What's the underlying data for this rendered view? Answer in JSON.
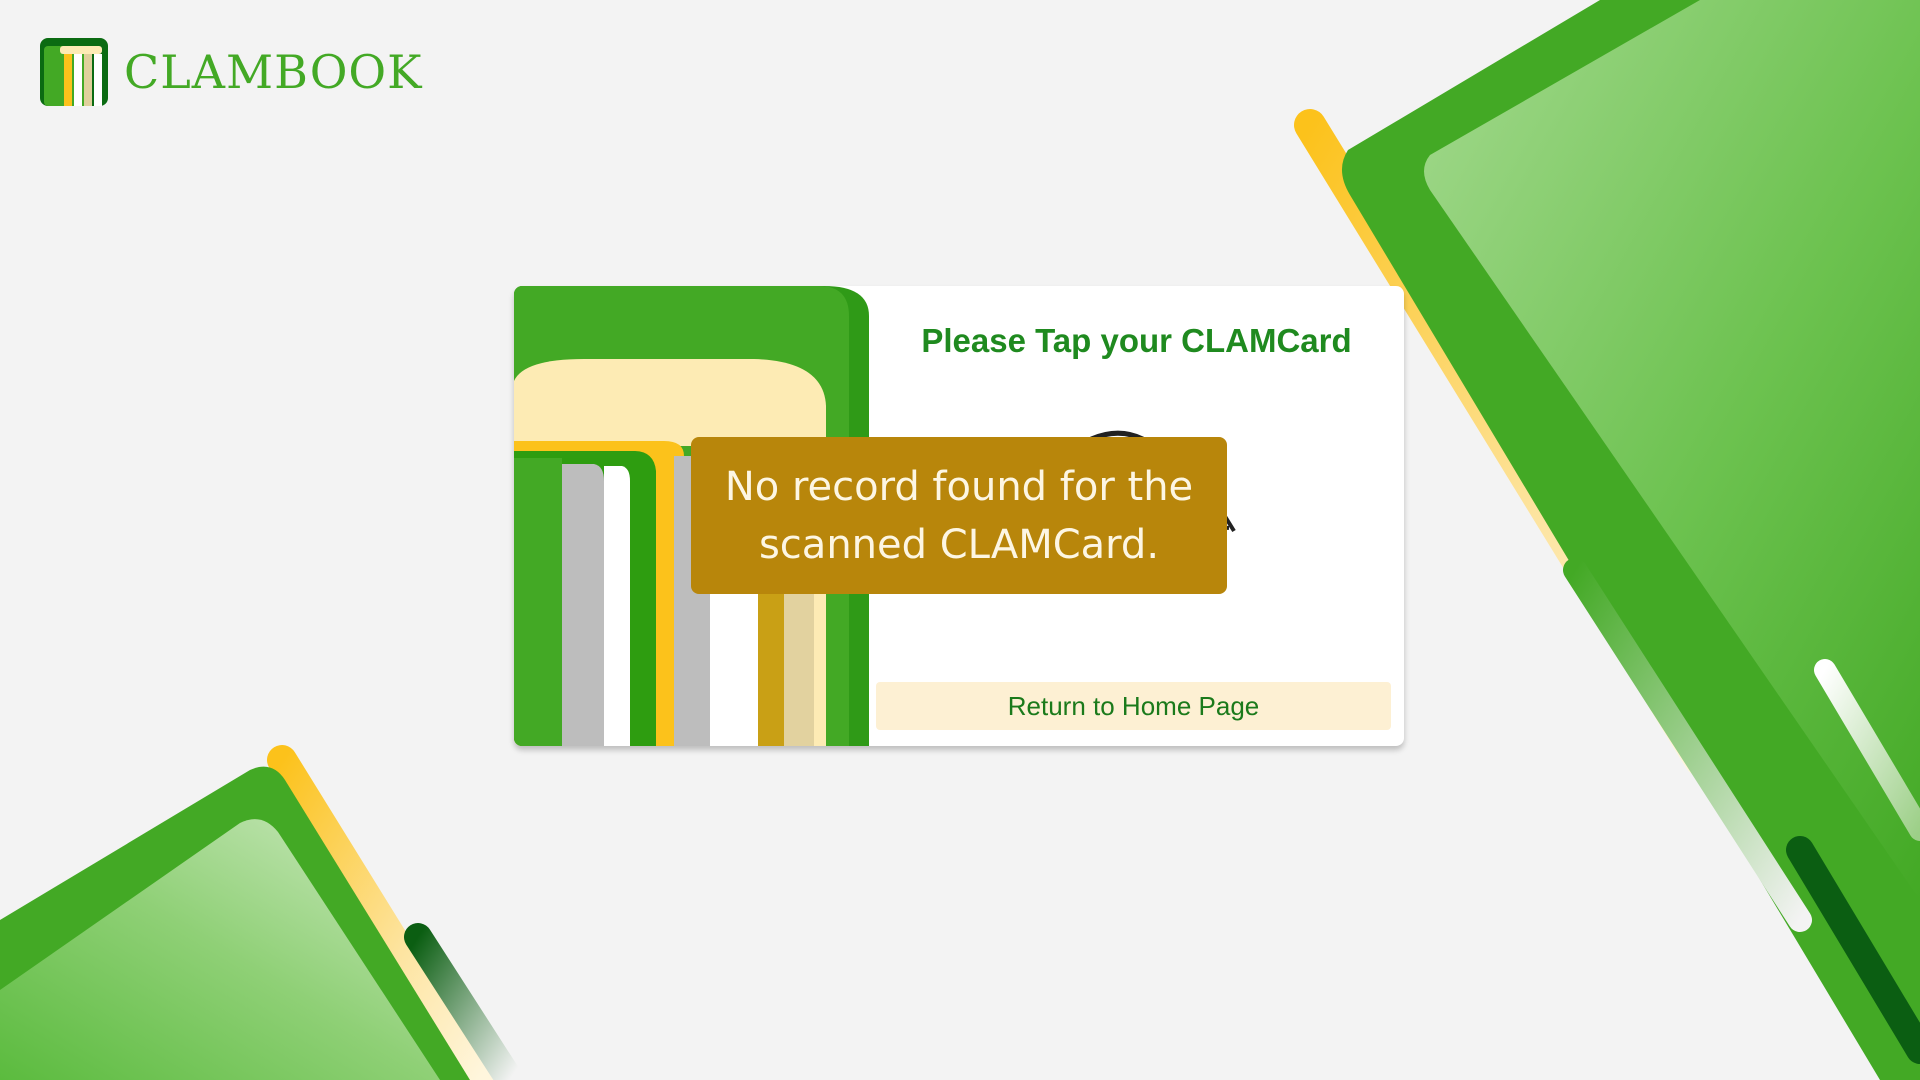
{
  "brand": {
    "name": "CLAMBOOK",
    "color": "#43a925"
  },
  "card": {
    "title": "Please Tap your CLAMCard",
    "icon": "card-tap-icon",
    "return_button_label": "Return to Home Page"
  },
  "alert": {
    "message": "No record found for the scanned CLAMCard.",
    "color": "#b8860b"
  },
  "colors": {
    "primary_green": "#43a925",
    "dark_green": "#0b5e12",
    "accent_yellow": "#fcc21b",
    "cream": "#fdebb4",
    "background": "#f3f3f3"
  }
}
